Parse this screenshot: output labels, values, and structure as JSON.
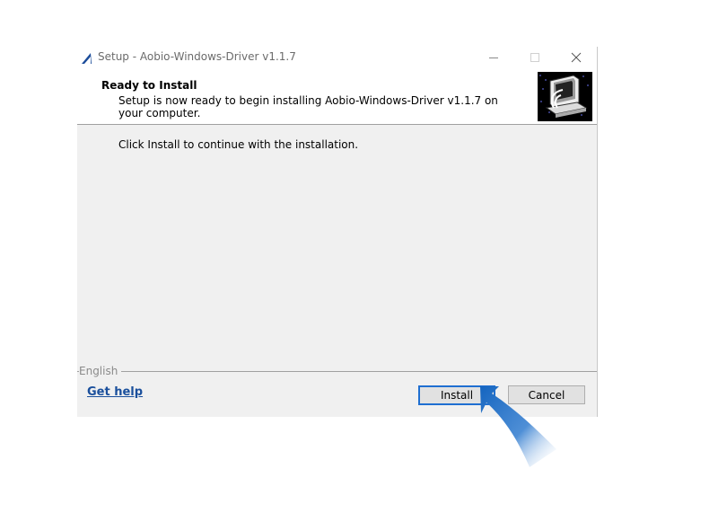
{
  "window": {
    "title": "Setup - Aobio-Windows-Driver v1.1.7",
    "controls": [
      "minimize-icon",
      "maximize-icon",
      "close-icon"
    ]
  },
  "header": {
    "title": "Ready to Install",
    "description": "Setup is now ready to begin installing Aobio-Windows-Driver v1.1.7 on your computer.",
    "image": "installer-computer-icon"
  },
  "body": {
    "instruction": "Click Install to continue with the installation."
  },
  "footer": {
    "language": "English",
    "help_link": "Get help",
    "install_label": "Install",
    "cancel_label": "Cancel"
  },
  "colors": {
    "accent": "#1f6fd1",
    "link": "#1a4f9c",
    "dialog_bg": "#f0f0f0",
    "arrow": "#1565c0"
  }
}
